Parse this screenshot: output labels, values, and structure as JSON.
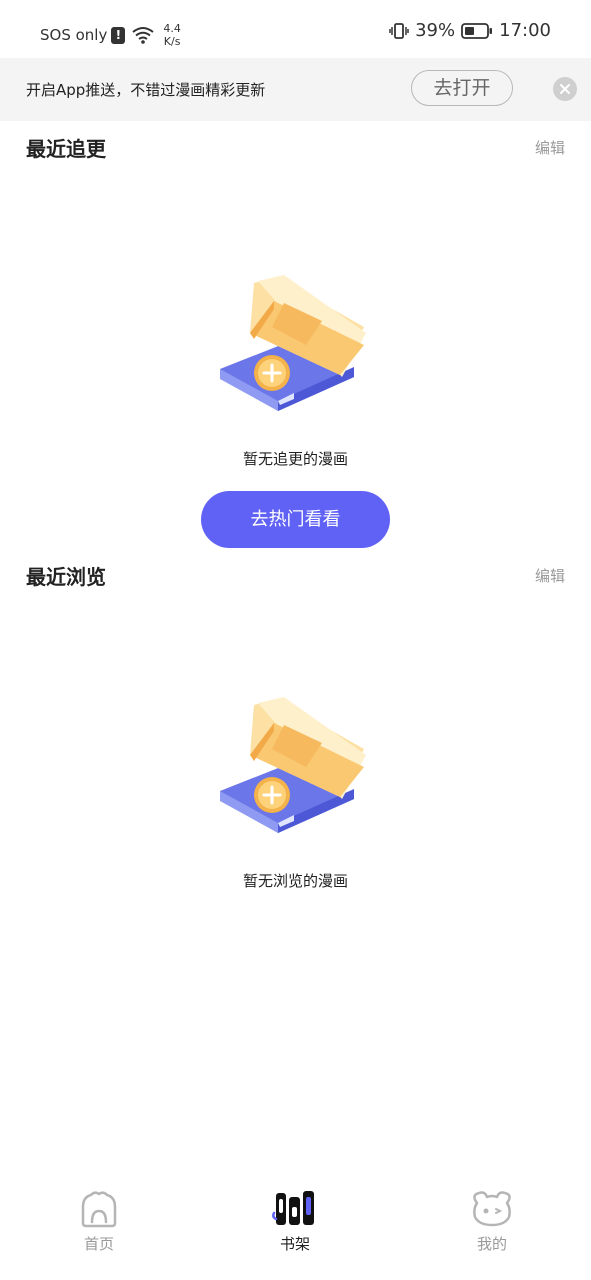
{
  "status_bar": {
    "carrier": "SOS only",
    "alert_glyph": "!",
    "speed_value": "4.4",
    "speed_unit": "K/s",
    "battery": "39%",
    "time": "17:00"
  },
  "banner": {
    "text": "开启App推送，不错过漫画精彩更新",
    "button_label": "去打开"
  },
  "sections": [
    {
      "title": "最近追更",
      "edit_label": "编辑",
      "empty_text": "暂无追更的漫画",
      "action_label": "去热门看看"
    },
    {
      "title": "最近浏览",
      "edit_label": "编辑",
      "empty_text": "暂无浏览的漫画"
    }
  ],
  "bottom_nav": {
    "items": [
      {
        "label": "首页",
        "icon": "home-icon",
        "active": false
      },
      {
        "label": "书架",
        "icon": "bookshelf-icon",
        "active": true
      },
      {
        "label": "我的",
        "icon": "profile-icon",
        "active": false
      }
    ]
  },
  "colors": {
    "accent": "#6062f5",
    "banner_bg": "#f4f4f4",
    "inactive_nav": "#999999"
  }
}
